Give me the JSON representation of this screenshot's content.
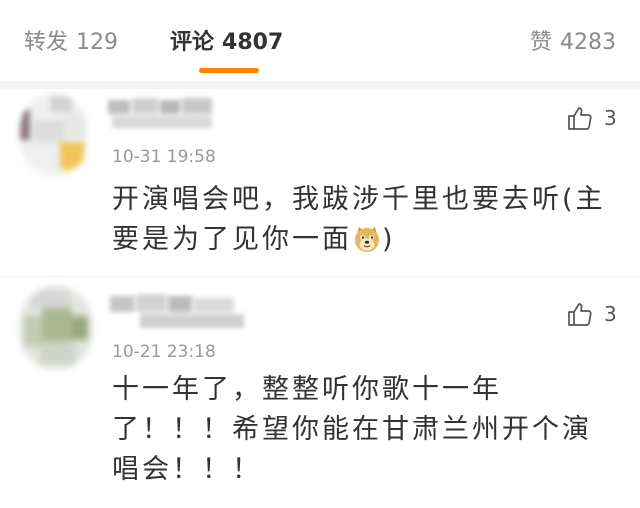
{
  "tabs": {
    "repost": {
      "label": "转发",
      "count": "129",
      "active": false
    },
    "comments": {
      "label": "评论",
      "count": "4807",
      "active": true
    },
    "likes": {
      "label": "赞",
      "count": "4283",
      "active": false
    }
  },
  "icons": {
    "like": "thumbs-up-icon",
    "emoji": "doge-emoji-icon"
  },
  "colors": {
    "accent": "#ff8200",
    "text": "#333333",
    "meta": "#999999",
    "tab_inactive": "#8a8a8a",
    "divider": "#ededed"
  },
  "comments": [
    {
      "time": "10-31 19:58",
      "likes": "3",
      "lines": [
        "开演唱会吧，我跋涉千里也要去听(主",
        "要是为了见你一面"
      ],
      "after_emoji": ")"
    },
    {
      "time": "10-21 23:18",
      "likes": "3",
      "lines": [
        "十一年了，整整听你歌十一年",
        "了！！！希望你能在甘肃兰州开个演",
        "唱会！！！"
      ]
    }
  ]
}
